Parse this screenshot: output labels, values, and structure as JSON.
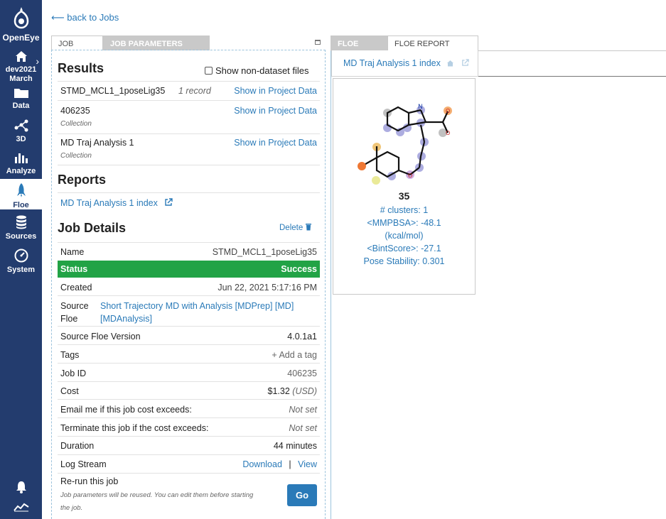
{
  "nav": {
    "brand": "OpenEye",
    "project_line1": "dev2021",
    "project_line2": "March",
    "items": [
      {
        "label": "Data",
        "icon": "folder-icon"
      },
      {
        "label": "3D",
        "icon": "molecule-3d-icon"
      },
      {
        "label": "Analyze",
        "icon": "bar-chart-icon"
      },
      {
        "label": "Floe",
        "icon": "rocket-icon"
      },
      {
        "label": "Sources",
        "icon": "database-icon"
      },
      {
        "label": "System",
        "icon": "gauge-icon"
      }
    ],
    "active": "Floe"
  },
  "back_link": "back to Jobs",
  "left_tabs": {
    "job": "JOB",
    "params": "JOB PARAMETERS"
  },
  "results": {
    "title": "Results",
    "show_non_dataset": "Show non-dataset files",
    "rows": [
      {
        "name": "STMD_MCL1_1poseLig35",
        "count": "1 record",
        "action": "Show in Project Data",
        "sub": ""
      },
      {
        "name": "406235",
        "count": "",
        "action": "Show in Project Data",
        "sub": "Collection"
      },
      {
        "name": "MD Traj Analysis 1",
        "count": "",
        "action": "Show in Project Data",
        "sub": "Collection"
      }
    ]
  },
  "reports": {
    "title": "Reports",
    "link": "MD Traj Analysis 1 index"
  },
  "job_details": {
    "title": "Job Details",
    "delete": "Delete",
    "name_label": "Name",
    "name_value": "STMD_MCL1_1poseLig35",
    "status_label": "Status",
    "status_value": "Success",
    "created_label": "Created",
    "created_value": "Jun 22, 2021 5:17:16 PM",
    "source_label_1": "Source",
    "source_label_2": "Floe",
    "source_value_1": "Short Trajectory MD with Analysis [MDPrep] [MD]",
    "source_value_2": "[MDAnalysis]",
    "version_label": "Source Floe Version",
    "version_value": "4.0.1a1",
    "tags_label": "Tags",
    "tags_value": "+ Add a tag",
    "jobid_label": "Job ID",
    "jobid_value": "406235",
    "cost_label": "Cost",
    "cost_value": "$1.32",
    "cost_unit": "(USD)",
    "email_label": "Email me if this job cost exceeds:",
    "email_value": "Not set",
    "term_label": "Terminate this job if the cost exceeds:",
    "term_value": "Not set",
    "duration_label": "Duration",
    "duration_value": "44 minutes",
    "log_label": "Log Stream",
    "log_download": "Download",
    "log_sep": "|",
    "log_view": "View",
    "rerun_label": "Re-run this job",
    "rerun_note_1": "Job parameters will be reused. You can edit them before starting",
    "rerun_note_2": "the job.",
    "go": "Go"
  },
  "right_tabs": {
    "floe": "FLOE",
    "report": "FLOE REPORT"
  },
  "report_tab": "MD Traj Analysis 1 index",
  "card": {
    "number": "35",
    "line1": "# clusters: 1",
    "line2": "<MMPBSA>: -48.1",
    "line3": "(kcal/mol)",
    "line4": "<BintScore>: -27.1",
    "line5": "Pose Stability: 0.301"
  },
  "colors": {
    "nav_bg": "#233c6e",
    "link": "#2a7ab8",
    "success": "#22a346",
    "button": "#2a7ab8"
  }
}
